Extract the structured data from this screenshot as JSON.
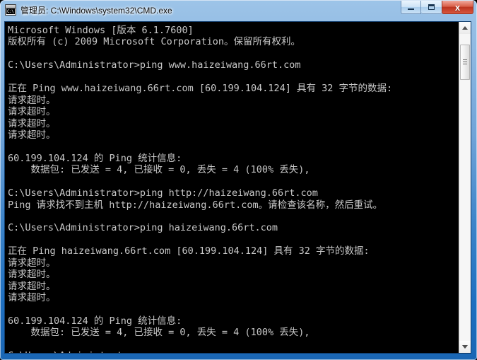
{
  "window": {
    "title": "管理员: C:\\Windows\\system32\\CMD.exe",
    "icon_name": "cmd-console-icon",
    "icon_text": "C:\\",
    "frame_color": "#1e6fc0",
    "console_bg": "#000000",
    "console_fg": "#c8c8c8"
  },
  "titlebar_buttons": {
    "minimize_label": "_",
    "maximize_label": "□",
    "close_label": "x"
  },
  "scrollbar": {
    "up_arrow": "▲",
    "down_arrow": "▼",
    "thumb_position_pct": 4
  },
  "console": {
    "lines": [
      "Microsoft Windows [版本 6.1.7600]",
      "版权所有 (c) 2009 Microsoft Corporation。保留所有权利。",
      "",
      "C:\\Users\\Administrator>ping www.haizeiwang.66rt.com",
      "",
      "正在 Ping www.haizeiwang.66rt.com [60.199.104.124] 具有 32 字节的数据:",
      "请求超时。",
      "请求超时。",
      "请求超时。",
      "请求超时。",
      "",
      "60.199.104.124 的 Ping 统计信息:",
      "    数据包: 已发送 = 4, 已接收 = 0, 丢失 = 4 (100% 丢失),",
      "",
      "C:\\Users\\Administrator>ping http://haizeiwang.66rt.com",
      "Ping 请求找不到主机 http://haizeiwang.66rt.com。请检查该名称，然后重试。",
      "",
      "C:\\Users\\Administrator>ping haizeiwang.66rt.com",
      "",
      "正在 Ping haizeiwang.66rt.com [60.199.104.124] 具有 32 字节的数据:",
      "请求超时。",
      "请求超时。",
      "请求超时。",
      "请求超时。",
      "",
      "60.199.104.124 的 Ping 统计信息:",
      "    数据包: 已发送 = 4, 已接收 = 0, 丢失 = 4 (100% 丢失),",
      "",
      "C:\\Users\\Administrator>"
    ]
  }
}
